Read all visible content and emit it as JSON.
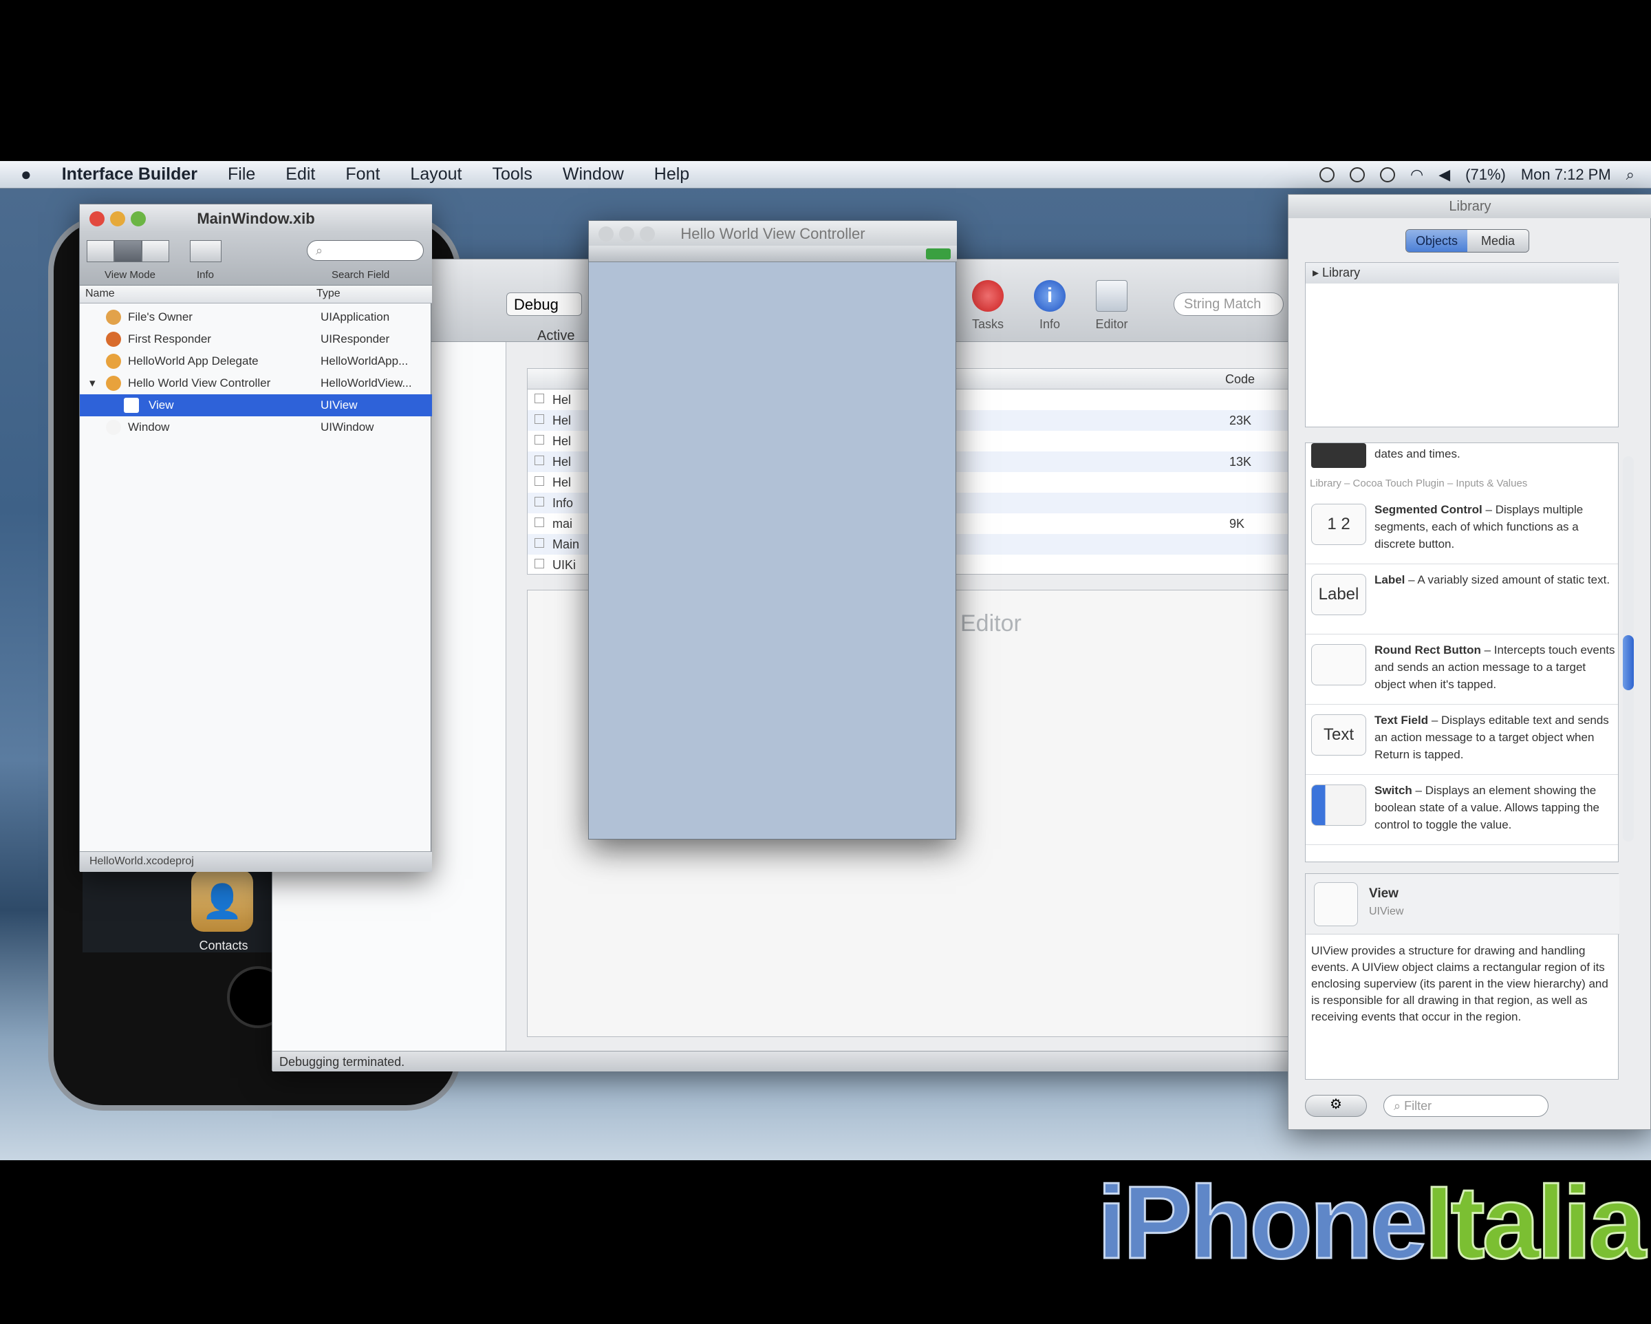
{
  "menubar": {
    "app": "Interface Builder",
    "items": [
      "File",
      "Edit",
      "Font",
      "Layout",
      "Tools",
      "Window",
      "Help"
    ],
    "battery": "(71%)",
    "clock": "Mon 7:12 PM"
  },
  "springboard": {
    "contacts_label": "Contacts"
  },
  "xcode": {
    "config": "Debug",
    "active_label": "Active",
    "toolbar": {
      "tasks": "Tasks",
      "info": "Info",
      "editor": "Editor"
    },
    "search_placeholder": "String Match",
    "col_code": "Code",
    "rows": [
      {
        "name": "Hel",
        "code": ""
      },
      {
        "name": "Hel",
        "code": "23K"
      },
      {
        "name": "Hel",
        "code": ""
      },
      {
        "name": "Hel",
        "code": "13K"
      },
      {
        "name": "Hel",
        "code": ""
      },
      {
        "name": "Info",
        "code": ""
      },
      {
        "name": "mai",
        "code": "9K"
      },
      {
        "name": "Main",
        "code": ""
      },
      {
        "name": "UIKi",
        "code": ""
      }
    ],
    "editor_label": "Editor",
    "status": "Debugging terminated."
  },
  "xib": {
    "title": "MainWindow.xib",
    "view_mode_label": "View Mode",
    "info_label": "Info",
    "search_label": "Search Field",
    "col_name": "Name",
    "col_type": "Type",
    "rows": [
      {
        "name": "File's Owner",
        "type": "UIApplication",
        "color": "#e2a24a"
      },
      {
        "name": "First Responder",
        "type": "UIResponder",
        "color": "#d86b2c"
      },
      {
        "name": "HelloWorld App Delegate",
        "type": "HelloWorldApp...",
        "color": "#e8a23c"
      },
      {
        "name": "Hello World View Controller",
        "type": "HelloWorldView...",
        "color": "#e8a23c"
      },
      {
        "name": "View",
        "type": "UIView",
        "color": "#ffffff"
      },
      {
        "name": "Window",
        "type": "UIWindow",
        "color": "#f4f4f4"
      }
    ],
    "status": "HelloWorld.xcodeproj"
  },
  "hwvc": {
    "title": "Hello World View Controller"
  },
  "library": {
    "title": "Library",
    "tab_objects": "Objects",
    "tab_media": "Media",
    "tree_root": "Library",
    "first_item_tail": "dates and times.",
    "crumb": "Library – Cocoa Touch Plugin – Inputs & Values",
    "items": [
      {
        "thumb": "1 2",
        "title": "Segmented Control",
        "text": " – Displays multiple segments, each of which functions as a discrete button."
      },
      {
        "thumb": "Label",
        "title": "Label",
        "text": " – A variably sized amount of static text."
      },
      {
        "thumb": "",
        "title": "Round Rect Button",
        "text": " – Intercepts touch events and sends an action message to a target object when it's tapped."
      },
      {
        "thumb": "Text",
        "title": "Text Field",
        "text": " – Displays editable text and sends an action message to a target object when Return is tapped."
      },
      {
        "thumb": "",
        "title": "Switch",
        "text": " – Displays an element showing the boolean state of a value. Allows tapping the control to toggle the value."
      }
    ],
    "detail_name": "View",
    "detail_type": "UIView",
    "detail_text": "UIView provides a structure for drawing and handling events. A UIView object claims a rectangular region of its enclosing superview (its parent in the view hierarchy) and is responsible for all drawing in that region, as well as receiving events that occur in the region.",
    "filter_placeholder": "Filter"
  },
  "watermark": {
    "part1": "iPhone",
    "part2": "Italia"
  }
}
